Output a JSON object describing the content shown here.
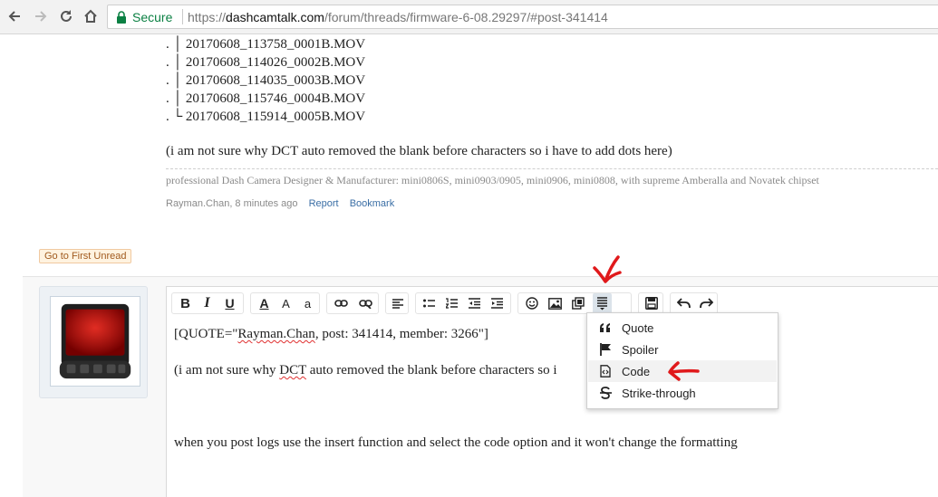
{
  "browser": {
    "security_label": "Secure",
    "url_scheme": "https://",
    "url_host": "dashcamtalk.com",
    "url_path": "/forum/threads/firmware-6-08.29297/#post-341414"
  },
  "post": {
    "files": [
      ". │ 20170608_113758_0001B.MOV",
      ". │ 20170608_114026_0002B.MOV",
      ". │ 20170608_114035_0003B.MOV",
      ". │ 20170608_115746_0004B.MOV",
      ". └ 20170608_115914_0005B.MOV"
    ],
    "note": "(i am not sure why DCT auto removed the blank before characters so i have to add dots here)",
    "signature": "professional Dash Camera Designer & Manufacturer: mini0806S, mini0903/0905, mini0906, mini0808, with supreme Amberalla and Novatek chipset",
    "author_time": "Rayman.Chan, 8 minutes ago",
    "report_label": "Report",
    "bookmark_label": "Bookmark"
  },
  "first_unread_label": "Go to First Unread",
  "editor": {
    "quote_prefix": "[QUOTE=\"",
    "quote_name": "Rayman.Chan",
    "quote_rest": ", post: 341414, member: 3266\"]",
    "line2_a": "(i am not sure why ",
    "line2_dct": "DCT",
    "line2_b": " auto removed the blank before characters so i",
    "line3": "when you post logs use the insert function and select the code option and it won't change the formatting"
  },
  "toolbar": {
    "bold": "B",
    "italic": "I",
    "underline": "U",
    "font_color": "A",
    "font_size": "A",
    "font_family": "a"
  },
  "insert_menu": {
    "items": [
      {
        "icon": "quote-icon",
        "label": "Quote"
      },
      {
        "icon": "flag-icon",
        "label": "Spoiler"
      },
      {
        "icon": "code-icon",
        "label": "Code"
      },
      {
        "icon": "strike-icon",
        "label": "Strike-through"
      }
    ],
    "highlighted": "Code"
  },
  "colors": {
    "secure_green": "#0b8043",
    "link_blue": "#3a6ea5",
    "annotation_red": "#e0191b"
  }
}
